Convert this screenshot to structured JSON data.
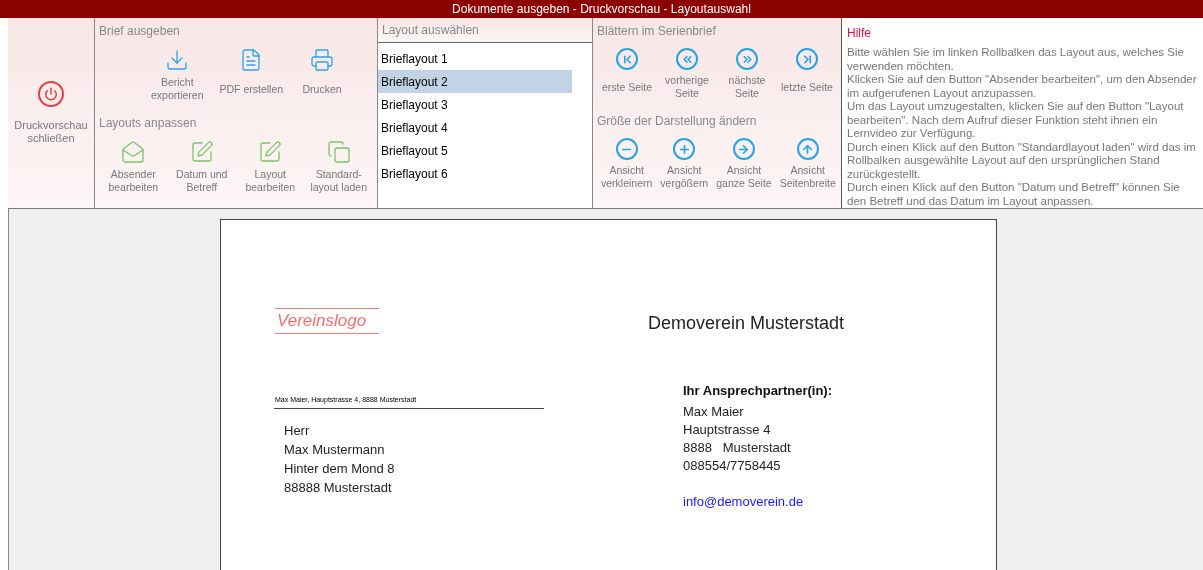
{
  "title": "Dokumente ausgeben - Druckvorschau  -  Layoutauswahl",
  "close_button": {
    "label": "Druckvorschau\nschließen"
  },
  "output_group": {
    "title": "Brief ausgeben",
    "buttons": [
      {
        "kind": "export",
        "label": "Bericht\nexportieren"
      },
      {
        "kind": "pdf",
        "label": "PDF erstellen"
      },
      {
        "kind": "print",
        "label": "Drucken"
      }
    ]
  },
  "customize_group": {
    "title": "Layouts anpassen",
    "buttons": [
      {
        "kind": "envelope",
        "label": "Absender\nbearbeiten"
      },
      {
        "kind": "edit",
        "label": "Datum und\nBetreff"
      },
      {
        "kind": "edit",
        "label": "Layout\nbearbeiten"
      },
      {
        "kind": "copy",
        "label": "Standard-\nlayout laden"
      }
    ]
  },
  "layout_list": {
    "title": "Layout auswählen",
    "items": [
      {
        "label": "Brieflayout 1",
        "selected": false
      },
      {
        "label": "Brieflayout 2",
        "selected": true
      },
      {
        "label": "Brieflayout 3",
        "selected": false
      },
      {
        "label": "Brieflayout 4",
        "selected": false
      },
      {
        "label": "Brieflayout 5",
        "selected": false
      },
      {
        "label": "Brieflayout 6",
        "selected": false
      }
    ]
  },
  "paging_group": {
    "title": "Blättern im Serienbrief",
    "buttons": [
      {
        "kind": "first",
        "label": "erste Seite"
      },
      {
        "kind": "prev",
        "label": "vorherige\nSeite"
      },
      {
        "kind": "next",
        "label": "nächste\nSeite"
      },
      {
        "kind": "last",
        "label": "letzte Seite"
      }
    ]
  },
  "zoom_group": {
    "title": "Größe der Darstellung ändern",
    "buttons": [
      {
        "kind": "minus",
        "label": "Ansicht\nverkleinern"
      },
      {
        "kind": "plus",
        "label": "Ansicht\nvergößern"
      },
      {
        "kind": "right",
        "label": "Ansicht\nganze Seite"
      },
      {
        "kind": "up",
        "label": "Ansicht\nSeitenbreite"
      }
    ]
  },
  "help": {
    "title": "Hilfe",
    "paragraphs": [
      "Bitte wählen Sie im linken Rollbalken das Layout aus, welches Sie verwenden möchten.",
      "Klicken Sie auf den Button \"Absender bearbeiten\", um den Absender im aufgerufenen Layout anzupassen.",
      "Um das Layout umzugestalten, klicken Sie auf den Button \"Layout bearbeiten\". Nach dem Aufruf dieser Funktion steht ihnen ein Lernvideo zur Verfügung.",
      "Durch einen Klick auf den Button \"Standardlayout laden\" wird das im Rollbalken ausgewählte Layout auf den ursprünglichen Stand zurückgestellt.",
      "Durch einen Klick auf den Button \"Datum und Betreff\" können Sie den Betreff und das Datum im Layout anpassen."
    ]
  },
  "letter": {
    "logo": "Vereinslogo",
    "organization": "Demoverein Musterstadt",
    "sender_line": "Max Maier, Hauptstrasse 4, 8888 Musterstadt",
    "recipient": [
      "Herr",
      "Max Mustermann",
      "Hinter dem Mond 8",
      "88888 Musterstadt"
    ],
    "contact_heading": "Ihr Ansprechpartner(in):",
    "contact": [
      "Max Maier",
      "Hauptstrasse 4",
      "8888   Musterstadt",
      "088554/7758445"
    ],
    "email": "info@demoverein.de"
  }
}
